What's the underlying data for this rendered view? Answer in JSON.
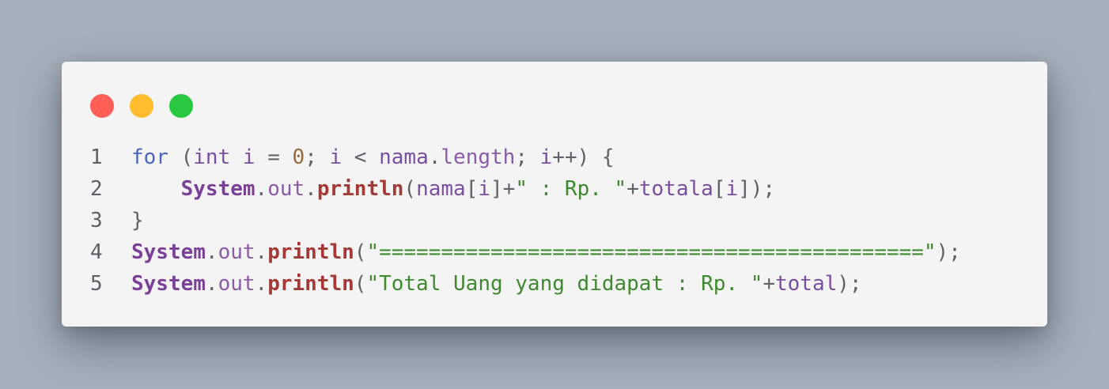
{
  "window_controls": {
    "close_color": "#ff5f57",
    "minimize_color": "#febc2e",
    "zoom_color": "#28c840"
  },
  "code": {
    "language": "java",
    "lines": [
      {
        "number": "1",
        "tokens": [
          {
            "text": "for",
            "kind": "kw"
          },
          {
            "text": " (",
            "kind": "op"
          },
          {
            "text": "int",
            "kind": "type"
          },
          {
            "text": " ",
            "kind": "op"
          },
          {
            "text": "i",
            "kind": "var"
          },
          {
            "text": " = ",
            "kind": "op"
          },
          {
            "text": "0",
            "kind": "num"
          },
          {
            "text": "; ",
            "kind": "op"
          },
          {
            "text": "i",
            "kind": "var"
          },
          {
            "text": " < ",
            "kind": "op"
          },
          {
            "text": "nama",
            "kind": "var"
          },
          {
            "text": ".",
            "kind": "op"
          },
          {
            "text": "length",
            "kind": "field"
          },
          {
            "text": "; ",
            "kind": "op"
          },
          {
            "text": "i",
            "kind": "var"
          },
          {
            "text": "++) {",
            "kind": "op"
          }
        ]
      },
      {
        "number": "2",
        "tokens": [
          {
            "text": "    ",
            "kind": "op"
          },
          {
            "text": "System",
            "kind": "cls"
          },
          {
            "text": ".",
            "kind": "op"
          },
          {
            "text": "out",
            "kind": "field"
          },
          {
            "text": ".",
            "kind": "op"
          },
          {
            "text": "println",
            "kind": "fn"
          },
          {
            "text": "(",
            "kind": "op"
          },
          {
            "text": "nama",
            "kind": "var"
          },
          {
            "text": "[",
            "kind": "op"
          },
          {
            "text": "i",
            "kind": "var"
          },
          {
            "text": "]+",
            "kind": "op"
          },
          {
            "text": "\" : Rp. \"",
            "kind": "str"
          },
          {
            "text": "+",
            "kind": "op"
          },
          {
            "text": "totala",
            "kind": "var"
          },
          {
            "text": "[",
            "kind": "op"
          },
          {
            "text": "i",
            "kind": "var"
          },
          {
            "text": "]);",
            "kind": "op"
          }
        ]
      },
      {
        "number": "3",
        "tokens": [
          {
            "text": "}",
            "kind": "op"
          }
        ]
      },
      {
        "number": "4",
        "tokens": [
          {
            "text": "System",
            "kind": "cls"
          },
          {
            "text": ".",
            "kind": "op"
          },
          {
            "text": "out",
            "kind": "field"
          },
          {
            "text": ".",
            "kind": "op"
          },
          {
            "text": "println",
            "kind": "fn"
          },
          {
            "text": "(",
            "kind": "op"
          },
          {
            "text": "\"============================================\"",
            "kind": "str"
          },
          {
            "text": ");",
            "kind": "op"
          }
        ]
      },
      {
        "number": "5",
        "tokens": [
          {
            "text": "System",
            "kind": "cls"
          },
          {
            "text": ".",
            "kind": "op"
          },
          {
            "text": "out",
            "kind": "field"
          },
          {
            "text": ".",
            "kind": "op"
          },
          {
            "text": "println",
            "kind": "fn"
          },
          {
            "text": "(",
            "kind": "op"
          },
          {
            "text": "\"Total Uang yang didapat : Rp. \"",
            "kind": "str"
          },
          {
            "text": "+",
            "kind": "op"
          },
          {
            "text": "total",
            "kind": "var"
          },
          {
            "text": ");",
            "kind": "op"
          }
        ]
      }
    ]
  }
}
